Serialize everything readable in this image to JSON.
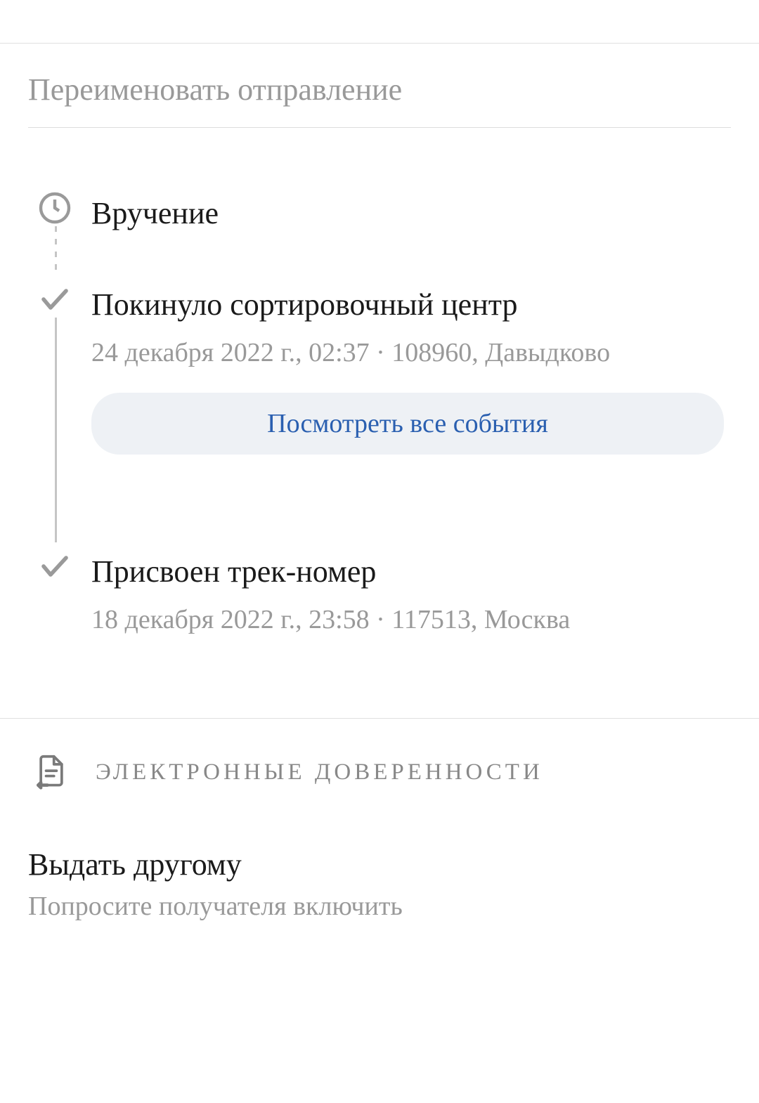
{
  "rename": {
    "placeholder": "Переименовать отправление"
  },
  "timeline": {
    "items": [
      {
        "title": "Вручение",
        "details": ""
      },
      {
        "title": "Покинуло сортировочный центр",
        "details": "24 декабря 2022 г., 02:37 · 108960, Давыдково"
      },
      {
        "title": "Присвоен трек-номер",
        "details": "18 декабря 2022 г., 23:58 · 117513, Москва"
      }
    ],
    "view_all_label": "Посмотреть все события"
  },
  "proxy": {
    "label": "ЭЛЕКТРОННЫЕ ДОВЕРЕННОСТИ"
  },
  "bottom": {
    "title": "Выдать другому",
    "subtitle": "Попросите получателя включить"
  }
}
